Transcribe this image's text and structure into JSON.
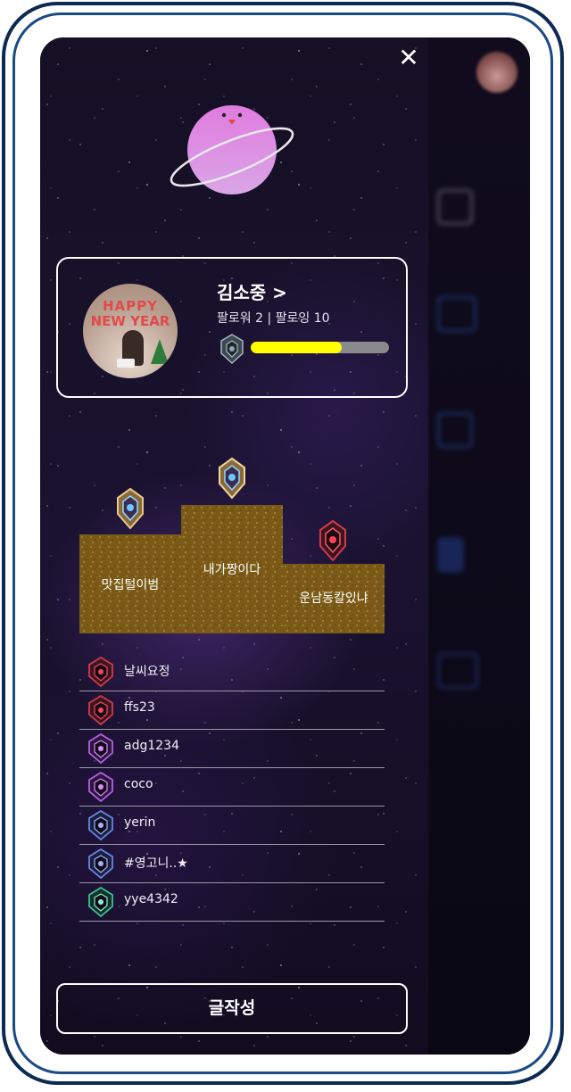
{
  "drawer": {
    "close_symbol": "✕",
    "profile": {
      "username": "김소중 >",
      "follow_text": "팔로워 2 | 팔로잉 10",
      "photo_text_line1": "HAPPY",
      "photo_text_line2": "NEW YEAR",
      "xp_progress": 0.66,
      "xp_color": "#ffff00"
    },
    "podium": {
      "first": "내가짱이다",
      "second": "맛집털이범",
      "third": "운남동칼있냐"
    },
    "ranking": [
      {
        "name": "날씨요정",
        "tier": "crimson"
      },
      {
        "name": "ffs23",
        "tier": "crimson"
      },
      {
        "name": "adg1234",
        "tier": "purple"
      },
      {
        "name": "coco",
        "tier": "purple"
      },
      {
        "name": "yerin",
        "tier": "blue"
      },
      {
        "name": "#영고니..★",
        "tier": "blue"
      },
      {
        "name": "yye4342",
        "tier": "green"
      }
    ],
    "write_button": "글작성"
  },
  "colors": {
    "frame": "#0d2a52",
    "frame_inner": "#1b4a86",
    "podium_gold": "#7a5a16"
  },
  "icons": [
    "close-icon",
    "planet-mascot-icon",
    "tier-emblem-icon"
  ]
}
